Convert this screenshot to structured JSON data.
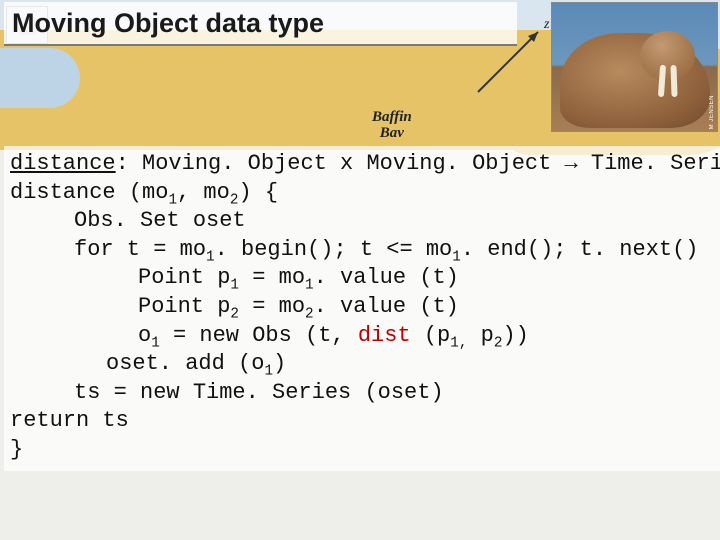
{
  "title": "Moving Object data type",
  "map": {
    "label_line1": "Baffin",
    "label_line2": "Bav",
    "axis_label": "z"
  },
  "walrus": {
    "credit": "M JENSEN"
  },
  "code": {
    "sig_name": "distance",
    "sig_rest": ": Moving. Object x Moving. Object → Time. Series",
    "l2_a": "distance (mo",
    "l2_b": ", mo",
    "l2_c": ") {",
    "l3": "Obs. Set oset",
    "l4_a": "for t = mo",
    "l4_b": ". begin(); t <= mo",
    "l4_c": ". end(); t. next()",
    "l5_a": "Point p",
    "l5_b": " = mo",
    "l5_c": ". value (t)",
    "l6_a": "Point p",
    "l6_b": " = mo",
    "l6_c": ". value (t)",
    "l7_a": "o",
    "l7_b": " = new Obs (t, ",
    "l7_kw": "dist",
    "l7_c": " (p",
    "l7_d": " p",
    "l7_e": "))",
    "l8_a": "oset. add (o",
    "l8_b": ")",
    "l9": "ts = new Time. Series (oset)",
    "l10": "return ts",
    "l11": "}",
    "sub1": "1",
    "sub2": "2",
    "comma": ","
  }
}
